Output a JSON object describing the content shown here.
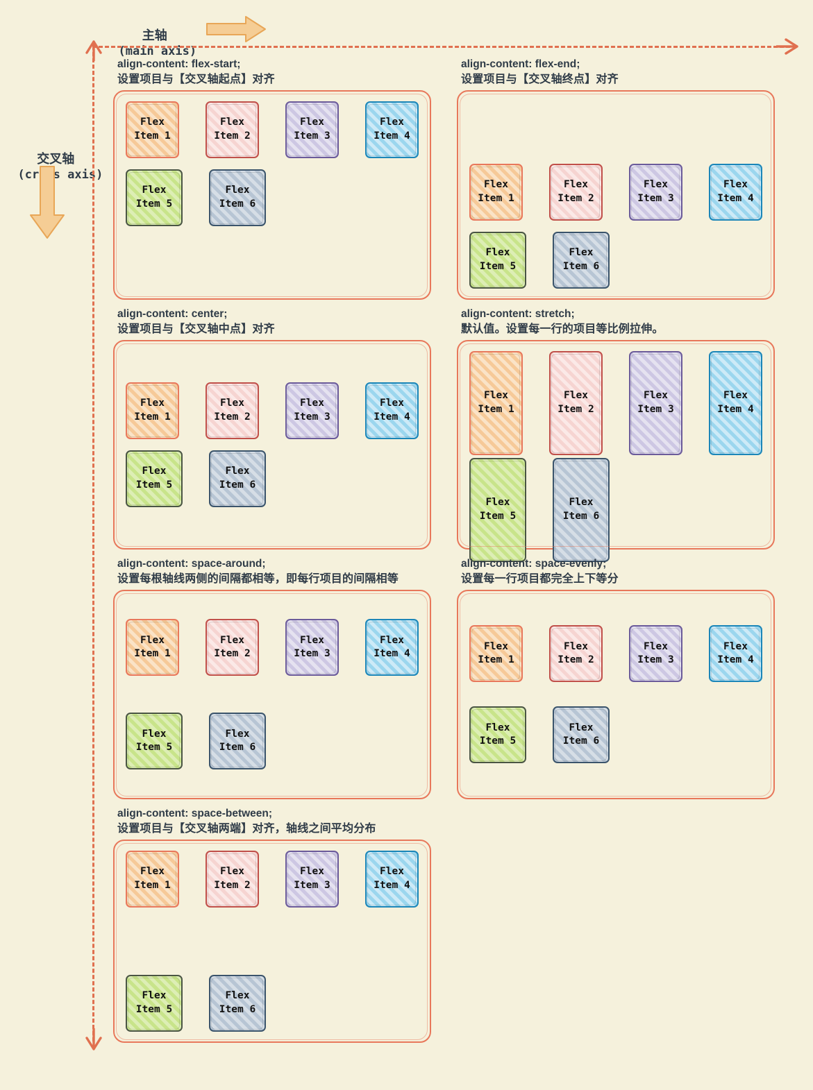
{
  "axes": {
    "main": {
      "cn": "主轴",
      "en": "(main axis)",
      "arrow": "arrow-right-icon",
      "color": "#f2c68a"
    },
    "cross": {
      "cn": "交叉轴",
      "en": "(cross axis)",
      "arrow": "arrow-down-icon",
      "color": "#f2c68a"
    }
  },
  "guide": {
    "color": "#e0704f",
    "start_arrow": "arrow-up-icon",
    "end_arrow": "arrow-down-icon",
    "main_arrow": "arrow-right-icon"
  },
  "items": [
    {
      "l1": "Flex",
      "l2": "Item 1",
      "color": "#e8785c"
    },
    {
      "l1": "Flex",
      "l2": "Item 2",
      "color": "#c0504a"
    },
    {
      "l1": "Flex",
      "l2": "Item 3",
      "color": "#6b5b9a"
    },
    {
      "l1": "Flex",
      "l2": "Item 4",
      "color": "#1c86b8"
    },
    {
      "l1": "Flex",
      "l2": "Item 5",
      "color": "#4a5544"
    },
    {
      "l1": "Flex",
      "l2": "Item 6",
      "color": "#3b546b"
    }
  ],
  "panels": [
    {
      "code": "align-content: flex-start;",
      "desc": "设置项目与【交叉轴起点】对齐"
    },
    {
      "code": "align-content: flex-end;",
      "desc": "设置项目与【交叉轴终点】对齐"
    },
    {
      "code": "align-content: center;",
      "desc": "设置项目与【交叉轴中点】对齐"
    },
    {
      "code": "align-content: stretch;",
      "desc": "默认值。设置每一行的项目等比例拉伸。"
    },
    {
      "code": "align-content: space-around;",
      "desc": "设置每根轴线两侧的间隔都相等，即每行项目的间隔相等"
    },
    {
      "code": "align-content: space-evenly;",
      "desc": "设置每一行项目都完全上下等分"
    },
    {
      "code": "align-content: space-between;",
      "desc": "设置项目与【交叉轴两端】对齐，轴线之间平均分布"
    }
  ]
}
